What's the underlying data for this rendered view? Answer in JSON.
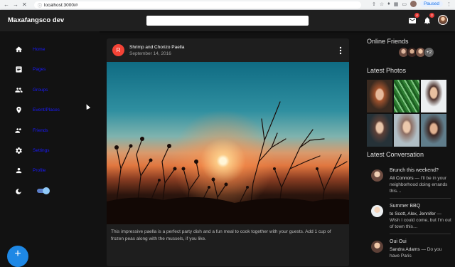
{
  "browser": {
    "url": "localhost:3000/#",
    "status": "Paused"
  },
  "appbar": {
    "brand": "Maxafangsco dev",
    "mail_badge": "4",
    "notif_badge": "2"
  },
  "sidebar": {
    "items": [
      {
        "label": "Home",
        "icon": "home-icon"
      },
      {
        "label": "Pages",
        "icon": "pages-icon"
      },
      {
        "label": "Groups",
        "icon": "groups-icon"
      },
      {
        "label": "Event/Places",
        "icon": "place-icon"
      },
      {
        "label": "Friends",
        "icon": "friends-icon"
      },
      {
        "label": "Settings",
        "icon": "settings-icon"
      },
      {
        "label": "Profile",
        "icon": "profile-icon"
      }
    ],
    "dark_mode": true,
    "fab_label": "+"
  },
  "post": {
    "avatar_letter": "R",
    "title": "Shrimp and Chorizo Paella",
    "date": "September 14, 2016",
    "text": "This impressive paella is a perfect party dish and a fun meal to cook together with your guests. Add 1 cup of frozen peas along with the mussels, if you like."
  },
  "right": {
    "online_title": "Online Friends",
    "online_more": "+2",
    "photos_title": "Latest Photos",
    "conversation_title": "Latest Conversation",
    "conversations": [
      {
        "title": "Brunch this weekend?",
        "sender": "Ali Connors",
        "text": " — I'll be in your neighborhood doing errands this…"
      },
      {
        "title": "Summer BBQ",
        "sender": "to Scott, Alex, Jennifer",
        "text": " — Wish I could come, but I'm out of town this…"
      },
      {
        "title": "Oui Oui",
        "sender": "Sandra Adams",
        "text": " — Do you have Paris"
      }
    ]
  },
  "colors": {
    "accent": "#1e88e5",
    "link": "#1a1aff",
    "post_avatar": "#f44336",
    "badge": "#e53935"
  }
}
